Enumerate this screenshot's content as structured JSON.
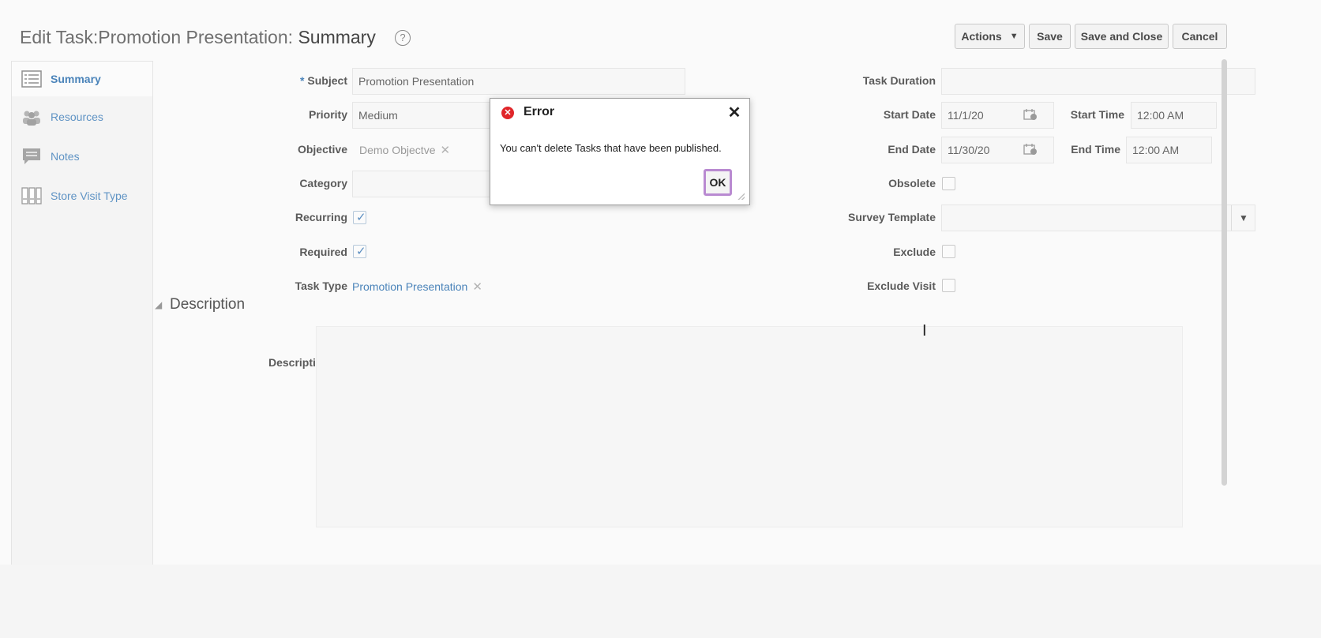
{
  "header": {
    "title_prefix": "Edit Task:Promotion Presentation:",
    "title_section": "Summary",
    "help_glyph": "?"
  },
  "toolbar": {
    "actions_label": "Actions",
    "actions_caret": "▼",
    "save_label": "Save",
    "save_close_label": "Save and Close",
    "cancel_label": "Cancel"
  },
  "sidebar": {
    "items": [
      {
        "label": "Summary",
        "icon": "list-icon",
        "active": true
      },
      {
        "label": "Resources",
        "icon": "people-icon"
      },
      {
        "label": "Notes",
        "icon": "note-icon"
      },
      {
        "label": "Store Visit Type",
        "icon": "binders-icon"
      }
    ]
  },
  "form": {
    "required_marker": "*",
    "subject": {
      "label": "Subject",
      "value": "Promotion Presentation"
    },
    "priority": {
      "label": "Priority",
      "value": "Medium"
    },
    "objective": {
      "label": "Objective",
      "value": "Demo Objectve",
      "clear": "✕"
    },
    "category": {
      "label": "Category",
      "value": ""
    },
    "recurring": {
      "label": "Recurring",
      "checked": true
    },
    "required": {
      "label": "Required",
      "checked": true
    },
    "task_type": {
      "label": "Task Type",
      "value": "Promotion Presentation",
      "clear": "✕"
    },
    "task_duration": {
      "label": "Task Duration",
      "value": ""
    },
    "start_date": {
      "label": "Start Date",
      "value": "11/1/20"
    },
    "start_time": {
      "label": "Start Time",
      "value": "12:00 AM"
    },
    "end_date": {
      "label": "End Date",
      "value": "11/30/20"
    },
    "end_time": {
      "label": "End Time",
      "value": "12:00 AM"
    },
    "obsolete": {
      "label": "Obsolete",
      "checked": false
    },
    "survey_template": {
      "label": "Survey Template",
      "value": "",
      "arrow": "▼"
    },
    "exclude": {
      "label": "Exclude",
      "checked": false
    },
    "exclude_visit": {
      "label": "Exclude Visit",
      "checked": false
    },
    "tick_glyph": "✓"
  },
  "description": {
    "section_title": "Description",
    "section_toggle": "◢",
    "field_label": "Description",
    "value": ""
  },
  "dialog": {
    "title": "Error",
    "icon": "error-icon",
    "icon_glyph": "✕",
    "close_glyph": "✕",
    "message": "You can't delete Tasks that have been published.",
    "ok_label": "OK"
  },
  "colors": {
    "link": "#4a83b9",
    "error": "#e0262a",
    "focus_ring": "#b98ad1"
  }
}
